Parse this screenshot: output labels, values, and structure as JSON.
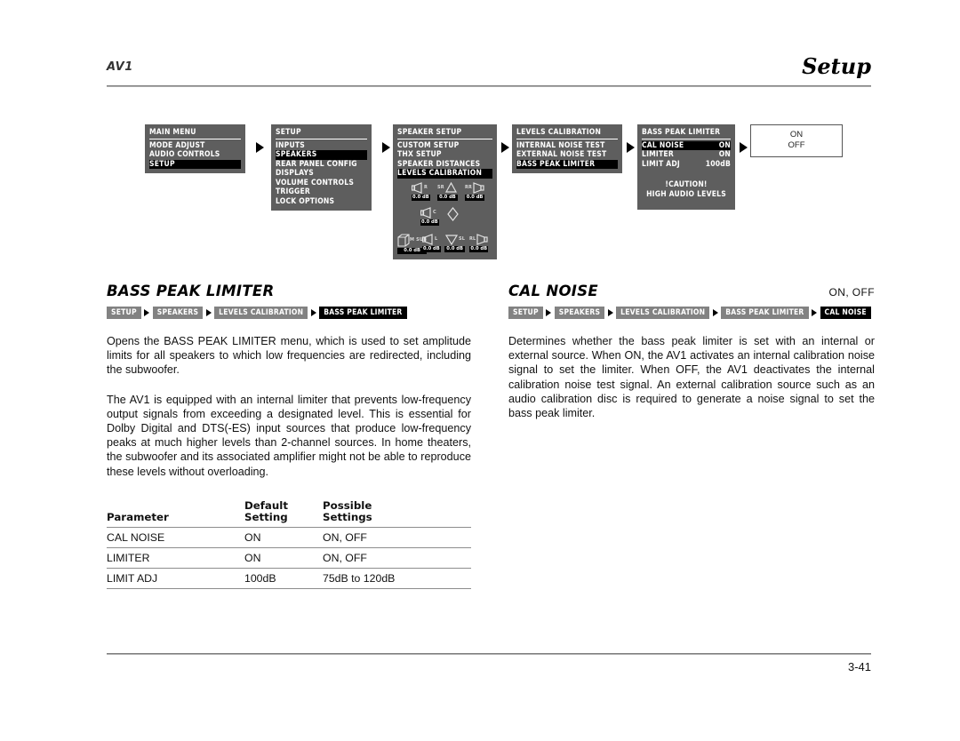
{
  "header": {
    "product": "AV1",
    "section": "Setup"
  },
  "footer": {
    "page_number": "3-41"
  },
  "osd_flow": {
    "panels": [
      {
        "id": "main-menu",
        "title": "MAIN MENU",
        "items": [
          {
            "label": "MODE ADJUST",
            "selected": false
          },
          {
            "label": "AUDIO CONTROLS",
            "selected": false
          },
          {
            "label": "SETUP",
            "selected": true
          }
        ]
      },
      {
        "id": "setup",
        "title": "SETUP",
        "items": [
          {
            "label": "INPUTS",
            "selected": false
          },
          {
            "label": "SPEAKERS",
            "selected": true
          },
          {
            "label": "REAR PANEL CONFIG",
            "selected": false
          },
          {
            "label": "DISPLAYS",
            "selected": false
          },
          {
            "label": "VOLUME CONTROLS",
            "selected": false
          },
          {
            "label": "TRIGGER",
            "selected": false
          },
          {
            "label": "LOCK OPTIONS",
            "selected": false
          }
        ]
      },
      {
        "id": "speaker-setup",
        "title": "SPEAKER SETUP",
        "items": [
          {
            "label": "CUSTOM SETUP",
            "selected": false
          },
          {
            "label": "THX SETUP",
            "selected": false
          },
          {
            "label": "SPEAKER DISTANCES",
            "selected": false
          },
          {
            "label": "LEVELS CALIBRATION",
            "selected": true
          }
        ],
        "speaker_levels": [
          {
            "channel": "R",
            "value": "0.0 dB",
            "icon": "speaker-left-facing-icon"
          },
          {
            "channel": "SR",
            "value": "0.0 dB",
            "icon": "surround-right-icon"
          },
          {
            "channel": "RR",
            "value": "0.0 dB",
            "icon": "speaker-right-facing-icon"
          },
          {
            "channel": "C",
            "value": "0.0 dB",
            "icon": "center-speaker-icon"
          },
          {
            "channel": "",
            "value": "",
            "icon": "listener-position-icon"
          },
          {
            "channel": "M SUB",
            "value": "0.0 dB",
            "icon": "subwoofer-cube-icon"
          },
          {
            "channel": "L",
            "value": "0.0 dB",
            "icon": "speaker-left-facing-icon"
          },
          {
            "channel": "SL",
            "value": "0.0 dB",
            "icon": "surround-left-icon"
          },
          {
            "channel": "RL",
            "value": "0.0 dB",
            "icon": "speaker-right-facing-icon"
          }
        ]
      },
      {
        "id": "levels-calibration",
        "title": "LEVELS CALIBRATION",
        "items": [
          {
            "label": "INTERNAL NOISE TEST",
            "selected": false
          },
          {
            "label": "EXTERNAL NOISE TEST",
            "selected": false
          },
          {
            "label": "BASS PEAK LIMITER",
            "selected": true
          }
        ]
      },
      {
        "id": "bass-peak-limiter",
        "title": "BASS PEAK LIMITER",
        "rows": [
          {
            "label": "CAL NOISE",
            "value": "ON",
            "selected": true
          },
          {
            "label": "LIMITER",
            "value": "ON",
            "selected": false
          },
          {
            "label": "LIMIT ADJ",
            "value": "100dB",
            "selected": false
          }
        ],
        "caution_line1": "!CAUTION!",
        "caution_line2": "HIGH AUDIO LEVELS"
      }
    ],
    "popup": {
      "options": [
        "ON",
        "OFF"
      ]
    }
  },
  "left_column": {
    "title": "BASS PEAK LIMITER",
    "breadcrumb": [
      "SETUP",
      "SPEAKERS",
      "LEVELS CALIBRATION",
      "BASS PEAK LIMITER"
    ],
    "paragraphs": [
      "Opens the BASS PEAK LIMITER menu, which is used to set amplitude limits for all speakers to which low frequencies are redirected, including the subwoofer.",
      "The AV1 is equipped with an internal limiter that prevents low-frequency output signals from exceeding a designated level. This is essential for Dolby Digital and DTS(-ES) input sources that produce low-frequency peaks at much higher levels than 2-channel sources. In home theaters, the subwoofer and its associated amplifier might not be able to reproduce these levels without overloading."
    ],
    "table": {
      "headers": {
        "col1": "Parameter",
        "col2_line1": "Default",
        "col2_line2": "Setting",
        "col3_line1": "Possible",
        "col3_line2": "Settings"
      },
      "rows": [
        {
          "parameter": "CAL NOISE",
          "default": "ON",
          "possible": "ON, OFF"
        },
        {
          "parameter": "LIMITER",
          "default": "ON",
          "possible": "ON, OFF"
        },
        {
          "parameter": "LIMIT ADJ",
          "default": "100dB",
          "possible": "75dB to 120dB"
        }
      ]
    }
  },
  "right_column": {
    "title": "CAL NOISE",
    "values": "ON, OFF",
    "breadcrumb": [
      "SETUP",
      "SPEAKERS",
      "LEVELS CALIBRATION",
      "BASS PEAK LIMITER",
      "CAL NOISE"
    ],
    "paragraphs": [
      "Determines whether the bass peak limiter is set with an internal or external source. When ON, the AV1 activates an internal calibration noise signal to set the limiter. When OFF, the AV1 deactivates the internal calibration noise test signal. An external calibration source such as an audio calibration disc is required to generate a noise signal to set the bass peak limiter."
    ]
  }
}
